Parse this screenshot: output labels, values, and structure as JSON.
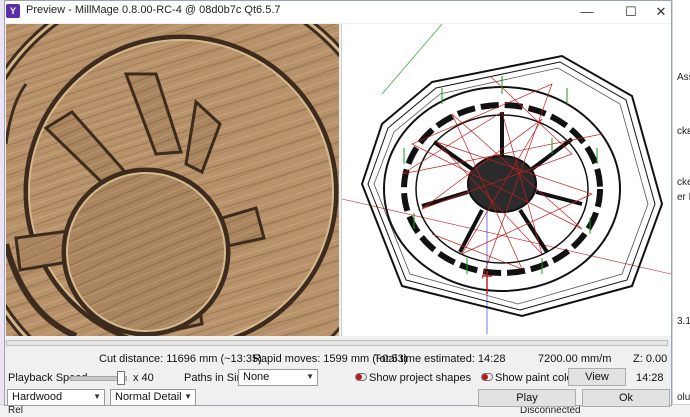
{
  "window": {
    "title": "Preview - MillMage 0.8.00-RC-4 @ 08d0b7c Qt6.5.7",
    "minimize": "—",
    "maximize": "☐",
    "close": "✕"
  },
  "background_app": {
    "right_fragments": [
      "Ass",
      "ckε",
      "cke",
      "er F",
      "3.1",
      "olu"
    ],
    "bottom_left": "Rel",
    "bottom_status": "Disconnected"
  },
  "stats": {
    "cut_distance": "Cut distance: 11696 mm (~13:35)",
    "rapid_moves": "Rapid moves: 1599 mm (~0:53)",
    "total_time": "Total time estimated: 14:28",
    "feed_rate": "7200.00 mm/m",
    "z_position": "Z: 0.00",
    "progress_fraction": 0.0
  },
  "controls": {
    "playback_speed_label": "Playback Speed",
    "playback_multiplier": "x 40",
    "playback_speed_fraction": 0.9,
    "paths_label": "Paths in Sim:",
    "paths_value": "None",
    "show_project_shapes": "Show project shapes",
    "show_paint_colors": "Show paint colors",
    "view_button": "View",
    "time_readout": "14:28",
    "material_value": "Hardwood",
    "detail_value": "Normal Detail",
    "play_button": "Play",
    "ok_button": "Ok"
  },
  "colors": {
    "wood_light": "#b7926a",
    "wood_dark": "#3d2c1d",
    "toolpath_red": "#c21f1f",
    "toolpath_green": "#1a9a1a",
    "toggle_red": "#b51b1b"
  }
}
